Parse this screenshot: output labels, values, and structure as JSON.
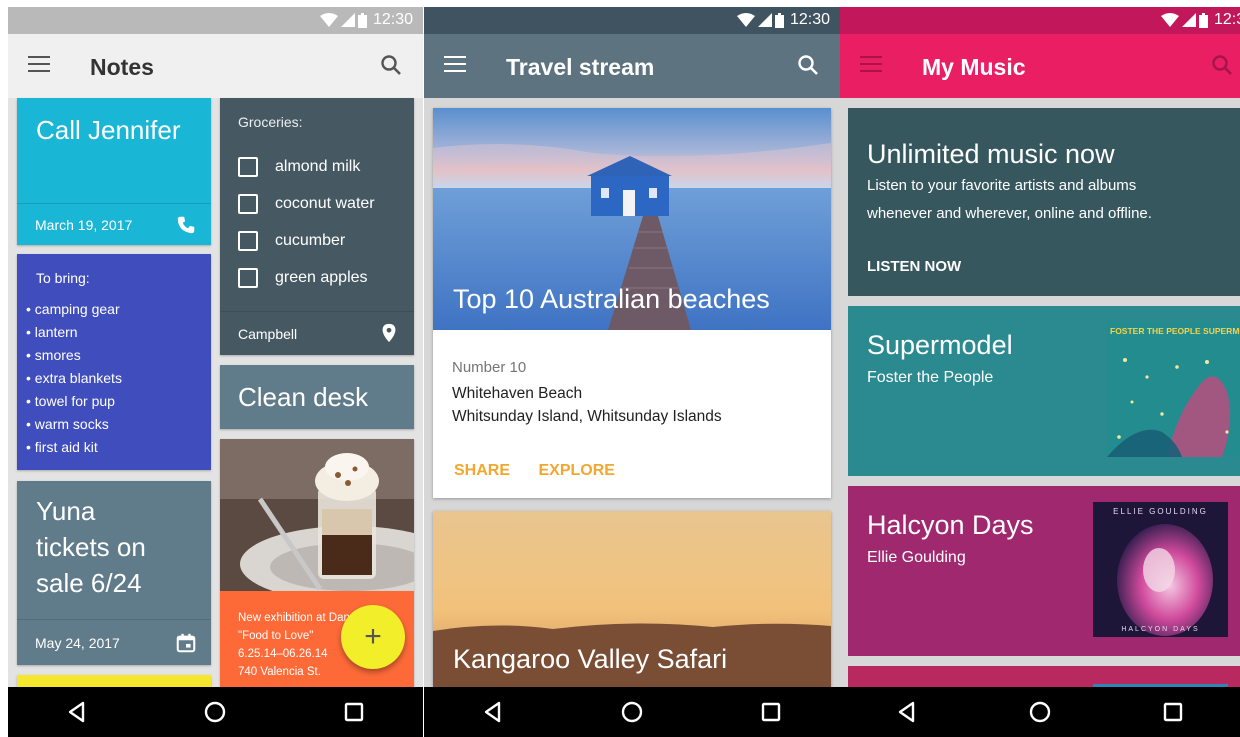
{
  "status_bar": {
    "time": "12:30"
  },
  "colors": {
    "notes_bar": "#f0f0f0",
    "notes_status": "#b9b9b9",
    "travel_bar": "#5d7380",
    "travel_status": "#3f5460",
    "music_bar": "#ea1e63",
    "music_status": "#c2185b",
    "cyan_note": "#1ab6d6",
    "indigo_note": "#3f4ebc",
    "slate_note": "#465963",
    "grey_note": "#607c8a",
    "orange_note": "#fd6a38",
    "yellow_note": "#f5e72e",
    "action_orange": "#f2a72e",
    "music_card1": "#37575f",
    "music_card2": "#2b8a8f",
    "music_card3": "#a0286f"
  },
  "notes_app": {
    "title": "Notes",
    "icons": {
      "menu": "menu-icon",
      "search": "search-icon"
    },
    "call": {
      "title": "Call Jennifer",
      "date": "March 19, 2017",
      "icon": "phone-icon"
    },
    "bring": {
      "heading": "To bring:",
      "items": [
        "• camping gear",
        "• lantern",
        "• smores",
        "• extra blankets",
        "• towel for pup",
        "• warm socks",
        "• first aid kit"
      ]
    },
    "yuna": {
      "line1": "Yuna",
      "line2": "tickets on",
      "line3": "sale 6/24",
      "date": "May 24, 2017",
      "icon": "calendar-icon"
    },
    "groceries": {
      "heading": "Groceries:",
      "items": [
        "almond milk",
        "coconut water",
        "cucumber",
        "green apples"
      ],
      "location": "Campbell",
      "icon": "location-pin-icon"
    },
    "clean_desk": "Clean desk",
    "exhibition": {
      "line1": "New exhibition at Dan",
      "line2": "\"Food to Love\"",
      "line3": "6.25.14–06.26.14",
      "line4": "740 Valencia St."
    },
    "fab_label": "+"
  },
  "travel_app": {
    "title": "Travel stream",
    "card1": {
      "hero_title": "Top 10 Australian beaches",
      "subtitle": "Number 10",
      "place": "Whitehaven Beach",
      "location": "Whitsunday Island, Whitsunday Islands",
      "share": "SHARE",
      "explore": "EXPLORE"
    },
    "card2": {
      "hero_title": "Kangaroo Valley Safari"
    }
  },
  "music_app": {
    "title": "My Music",
    "promo": {
      "title": "Unlimited music now",
      "line1": "Listen to your favorite artists and albums",
      "line2": "whenever and wherever, online and offline.",
      "action": "LISTEN NOW"
    },
    "album1": {
      "title": "Supermodel",
      "artist": "Foster the People",
      "cover_text": "FOSTER THE PEOPLE SUPERMODEL"
    },
    "album2": {
      "title": "Halcyon Days",
      "artist": "Ellie Goulding",
      "cover_top": "ELLIE GOULDING",
      "cover_bottom": "HALCYON DAYS"
    }
  },
  "nav": {
    "back": "back-icon",
    "home": "home-icon",
    "recents": "recents-icon"
  }
}
